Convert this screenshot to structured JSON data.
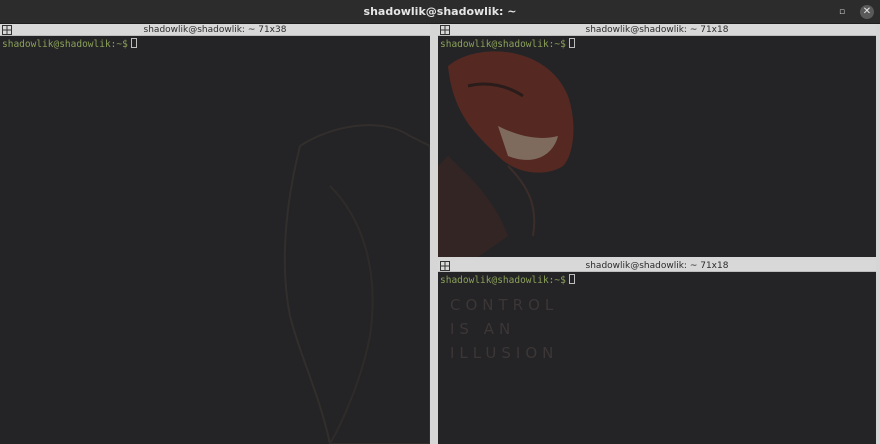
{
  "window": {
    "title": "shadowlik@shadowlik: ~"
  },
  "panes": [
    {
      "title": "shadowlik@shadowlik: ~ 71x38",
      "prompt": "shadowlik@shadowlik:~$"
    },
    {
      "title": "shadowlik@shadowlik: ~ 71x18",
      "prompt": "shadowlik@shadowlik:~$"
    },
    {
      "title": "shadowlik@shadowlik: ~ 71x18",
      "prompt": "shadowlik@shadowlik:~$"
    }
  ],
  "wallpaper": {
    "lines": [
      "CONTROL",
      "IS AN",
      "ILLUSION"
    ]
  },
  "colors": {
    "terminal_bg": "#242426",
    "prompt_green": "#8ba15a",
    "divider": "#d6d6d6",
    "mask_red": "#7a3326"
  },
  "icons": {
    "restore": "restore-icon",
    "close": "close-icon",
    "pane": "terminator-grid-icon"
  }
}
